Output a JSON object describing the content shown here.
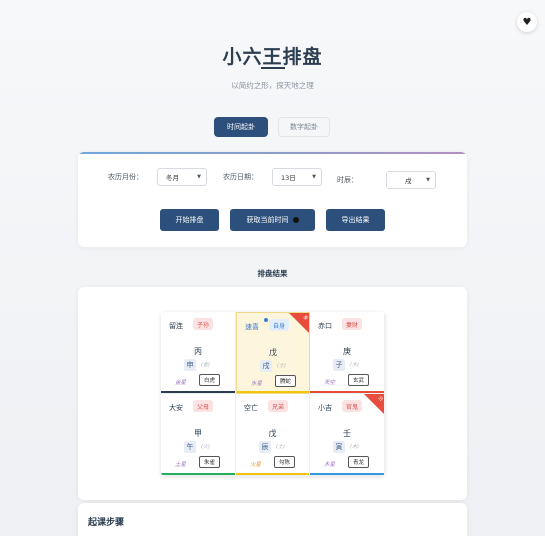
{
  "header": {
    "fav_icon": "heart-icon",
    "title": "小六王排盘",
    "subtitle": "以简约之形，探天地之理"
  },
  "mode_tabs": [
    {
      "label": "时间起卦",
      "active": true
    },
    {
      "label": "数字起卦",
      "active": false
    }
  ],
  "form": {
    "month_label": "农历月份：",
    "month_value": "冬月",
    "day_label": "农历日期：",
    "day_value": "13日",
    "hour_label": "时辰：",
    "hour_value": "戌",
    "buttons": {
      "start": "开始排盘",
      "now": "获取当前时间",
      "export": "导出结果"
    }
  },
  "result": {
    "title": "排盘结果",
    "palaces": [
      {
        "name": "留连",
        "tag": "子孙",
        "stem": "丙",
        "branch": "申",
        "element": "(金)",
        "star": "金星",
        "deity": "白虎",
        "bar": "#2c3e50",
        "name_color": "default",
        "tag_color": "red"
      },
      {
        "name": "速喜",
        "tag": "自身",
        "stem": "戊",
        "branch": "戌",
        "element": "(土)",
        "star": "水星",
        "deity": "腾蛇",
        "bar": "#f1c40f",
        "name_color": "blue",
        "tag_color": "blue",
        "highlight": true,
        "ribbon": "身"
      },
      {
        "name": "赤口",
        "tag": "妻财",
        "stem": "庚",
        "branch": "子",
        "element": "(水)",
        "star": "天空",
        "deity": "玄武",
        "bar": "#e74c3c",
        "name_color": "default",
        "tag_color": "red"
      },
      {
        "name": "大安",
        "tag": "父母",
        "stem": "甲",
        "branch": "午",
        "element": "(火)",
        "star": "土星",
        "deity": "朱雀",
        "bar": "#27ae60",
        "name_color": "default",
        "tag_color": "red"
      },
      {
        "name": "空亡",
        "tag": "兄弟",
        "stem": "戊",
        "branch": "辰",
        "element": "(土)",
        "star": "火星",
        "deity": "勾陈",
        "bar": "#f1c40f",
        "name_color": "default",
        "tag_color": "red"
      },
      {
        "name": "小吉",
        "tag": "官鬼",
        "stem": "壬",
        "branch": "寅",
        "element": "(木)",
        "star": "木星",
        "deity": "青龙",
        "bar": "#3498db",
        "name_color": "default",
        "tag_color": "red",
        "ribbon": "日"
      }
    ]
  },
  "steps": {
    "title": "起课步骤"
  }
}
